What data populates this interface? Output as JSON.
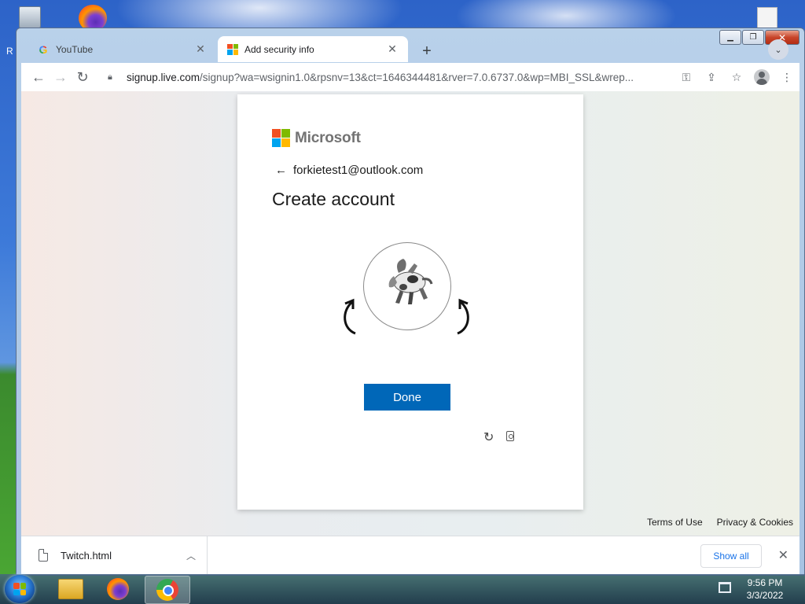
{
  "desktop": {
    "partial_label": "R"
  },
  "browser": {
    "tabs": [
      {
        "title": "YouTube",
        "favicon": "google-g-icon",
        "active": false
      },
      {
        "title": "Add security info",
        "favicon": "microsoft-icon",
        "active": true
      }
    ],
    "url": {
      "host": "signup.live.com",
      "path": "/signup?wa=wsignin1.0&rpsnv=13&ct=1646344481&rver=7.0.6737.0&wp=MBI_SSL&wrep..."
    }
  },
  "page": {
    "brand": "Microsoft",
    "brand_colors": [
      "#f25022",
      "#7fba00",
      "#00a4ef",
      "#ffb900"
    ],
    "identity": "forkietest1@outlook.com",
    "title": "Create account",
    "done_button": "Done",
    "done_color": "#0067b8",
    "footer": {
      "terms": "Terms of Use",
      "privacy": "Privacy & Cookies"
    }
  },
  "downloads": {
    "file": "Twitch.html",
    "show_all": "Show all"
  },
  "taskbar": {
    "time": "9:56 PM",
    "date": "3/3/2022",
    "apps": [
      "windows-explorer-icon",
      "firefox-icon",
      "chrome-icon"
    ]
  }
}
